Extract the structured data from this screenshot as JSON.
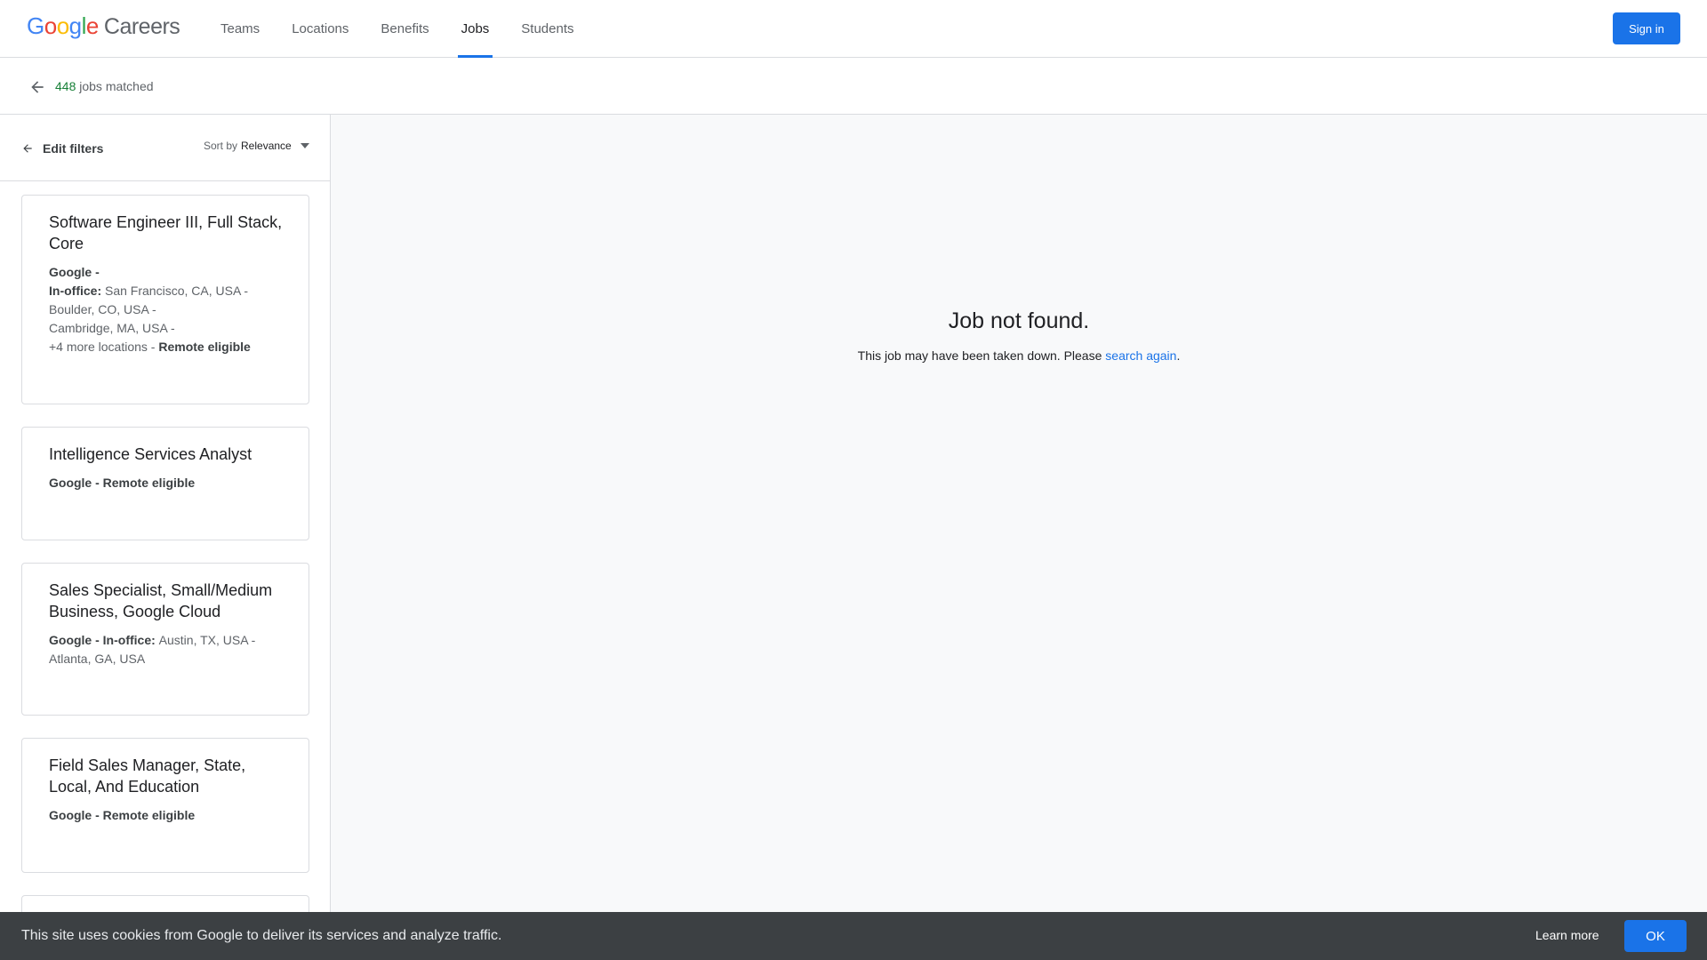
{
  "header": {
    "logo_letters": [
      "G",
      "o",
      "o",
      "g",
      "l",
      "e"
    ],
    "logo_suffix": "Careers",
    "nav": [
      {
        "label": "Teams",
        "active": false
      },
      {
        "label": "Locations",
        "active": false
      },
      {
        "label": "Benefits",
        "active": false
      },
      {
        "label": "Jobs",
        "active": true
      },
      {
        "label": "Students",
        "active": false
      }
    ],
    "signin_label": "Sign in"
  },
  "matchbar": {
    "count": "448",
    "suffix": " jobs matched"
  },
  "filters": {
    "edit_label": "Edit filters",
    "sort_prefix": "Sort by",
    "sort_value": "Relevance"
  },
  "jobs": [
    {
      "title": "Software Engineer III, Full Stack, Core",
      "company": "Google -",
      "inoffice_label": "In-office:",
      "line1": "San Francisco, CA, USA -",
      "line2": "Boulder, CO, USA -",
      "line3": "Cambridge, MA, USA -",
      "more": "+4 more locations - ",
      "remote": "Remote eligible"
    },
    {
      "title": "Intelligence Services Analyst",
      "company": "Google - Remote eligible"
    },
    {
      "title": "Sales Specialist, Small/Medium Business, Google Cloud",
      "company": "Google - In-office: ",
      "line1": "Austin, TX, USA -",
      "line2": "Atlanta, GA, USA"
    },
    {
      "title": "Field Sales Manager, State, Local, And Education",
      "company": "Google - Remote eligible"
    }
  ],
  "main": {
    "title": "Job not found.",
    "text": "This job may have been taken down. Please ",
    "link": "search again",
    "text_end": "."
  },
  "cookie": {
    "text": "This site uses cookies from Google to deliver its services and analyze traffic.",
    "learn_label": "Learn more",
    "ok_label": "OK"
  },
  "colors": {
    "accent": "#1a73e8",
    "count_green": "#188038",
    "cookie_bg": "#3c4043"
  }
}
